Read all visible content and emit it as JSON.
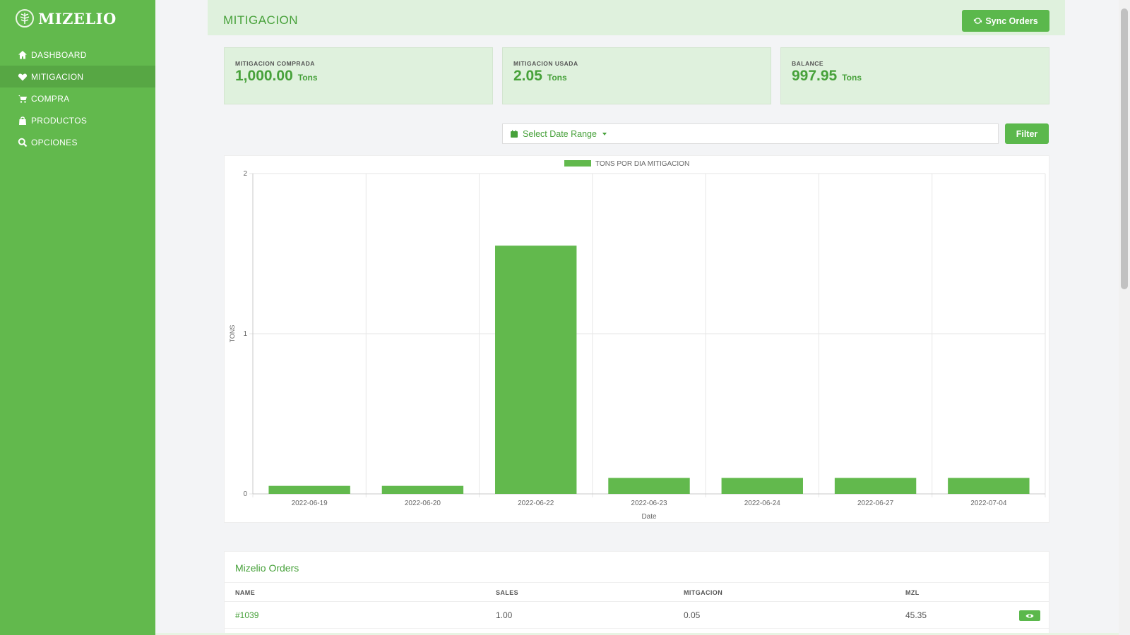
{
  "brand": {
    "name": "MIZELIO",
    "accent": "#62b94d",
    "accent_dark": "#47a13a"
  },
  "sidebar": {
    "items": [
      {
        "label": "DASHBOARD",
        "icon": "home-icon",
        "active": false
      },
      {
        "label": "MITIGACION",
        "icon": "heart-icon",
        "active": true
      },
      {
        "label": "COMPRA",
        "icon": "cart-icon",
        "active": false
      },
      {
        "label": "PRODUCTOS",
        "icon": "bag-icon",
        "active": false
      },
      {
        "label": "OPCIONES",
        "icon": "search-icon",
        "active": false
      }
    ]
  },
  "header": {
    "title": "MITIGACION",
    "sync_label": "Sync Orders"
  },
  "cards": [
    {
      "label": "MITIGACION COMPRADA",
      "value": "1,000.00",
      "unit": "Tons"
    },
    {
      "label": "MITIGACION USADA",
      "value": "2.05",
      "unit": "Tons"
    },
    {
      "label": "BALANCE",
      "value": "997.95",
      "unit": "Tons"
    }
  ],
  "filter": {
    "date_range_label": "Select Date Range",
    "filter_label": "Filter"
  },
  "chart_data": {
    "type": "bar",
    "categories": [
      "2022-06-19",
      "2022-06-20",
      "2022-06-22",
      "2022-06-23",
      "2022-06-24",
      "2022-06-27",
      "2022-07-04"
    ],
    "series": [
      {
        "name": "TONS POR DIA MITIGACION",
        "values": [
          0.05,
          0.05,
          1.55,
          0.1,
          0.1,
          0.1,
          0.1
        ],
        "color": "#62b94d"
      }
    ],
    "xlabel": "Date",
    "ylabel": "TONS",
    "ylim": [
      0,
      2
    ],
    "yticks": [
      0,
      1,
      2
    ],
    "grid": true,
    "legend": "top-center"
  },
  "orders": {
    "title": "Mizelio Orders",
    "columns": [
      "NAME",
      "SALES",
      "MITGACION",
      "MZL"
    ],
    "rows": [
      {
        "name": "#1039",
        "sales": "1.00",
        "mitigacion": "0.05",
        "mzl": "45.35"
      }
    ]
  }
}
